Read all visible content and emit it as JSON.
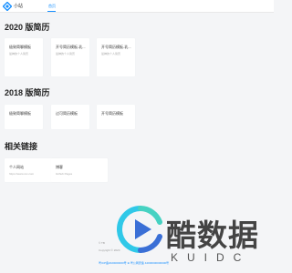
{
  "header": {
    "app_title": "小站",
    "nav": [
      {
        "label": "首页"
      }
    ],
    "accent_color": "#1890ff"
  },
  "sections": [
    {
      "title": "2020 版简历",
      "cards": [
        {
          "title": "极致简聊模板",
          "subtitle": "最神的个人简历"
        },
        {
          "title": "开号简历模板-乳...",
          "subtitle": "最神的个人简历"
        },
        {
          "title": "开号简历模板-乳...",
          "subtitle": "最神的个人简历"
        }
      ]
    },
    {
      "title": "2018 版简历",
      "cards": [
        {
          "title": "极致简聊模板",
          "subtitle": ""
        },
        {
          "title": "过可简历模板",
          "subtitle": ""
        },
        {
          "title": "开号简历模板",
          "subtitle": ""
        }
      ]
    },
    {
      "title": "相关链接",
      "cards": [
        {
          "title": "个人网站",
          "subtitle": "https://www.xxx.com"
        },
        {
          "title": "博客",
          "subtitle": "Github Pages"
        }
      ]
    }
  ],
  "footer": {
    "line1": "© TB",
    "line2": "Copyright © 2020",
    "beian": "粤ICP备2020000000号 ⊕ 粤公网安备 44000000000000号"
  },
  "watermark": {
    "brand_cn": "酷数据",
    "brand_en": "KUIDC",
    "colors": [
      "#2fc8e8",
      "#3a6fd6",
      "#46d2c2"
    ]
  }
}
